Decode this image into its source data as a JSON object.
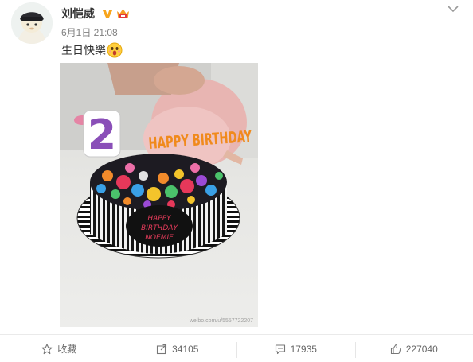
{
  "post": {
    "author": "刘恺威",
    "timestamp": "6月1日 21:08",
    "text": "生日快樂",
    "text_emoji": "surprised-face-emoji",
    "photo": {
      "cake_topper_text": "HAPPY BIRTHDAY",
      "cake_number": "2",
      "cake_plaque": [
        "HAPPY",
        "BIRTHDAY",
        "NOEMIE"
      ],
      "watermark": "weibo.com/u/5557722207"
    }
  },
  "header": {
    "verified_icon": "verified-v-icon",
    "member_icon": "vip-crown-icon",
    "more_icon": "chevron-down-icon",
    "accent_color": "#f7a51c"
  },
  "actions": [
    {
      "icon": "star-icon",
      "label": "收藏"
    },
    {
      "icon": "share-icon",
      "label": "34105"
    },
    {
      "icon": "comment-icon",
      "label": "17935"
    },
    {
      "icon": "like-icon",
      "label": "227040"
    }
  ]
}
